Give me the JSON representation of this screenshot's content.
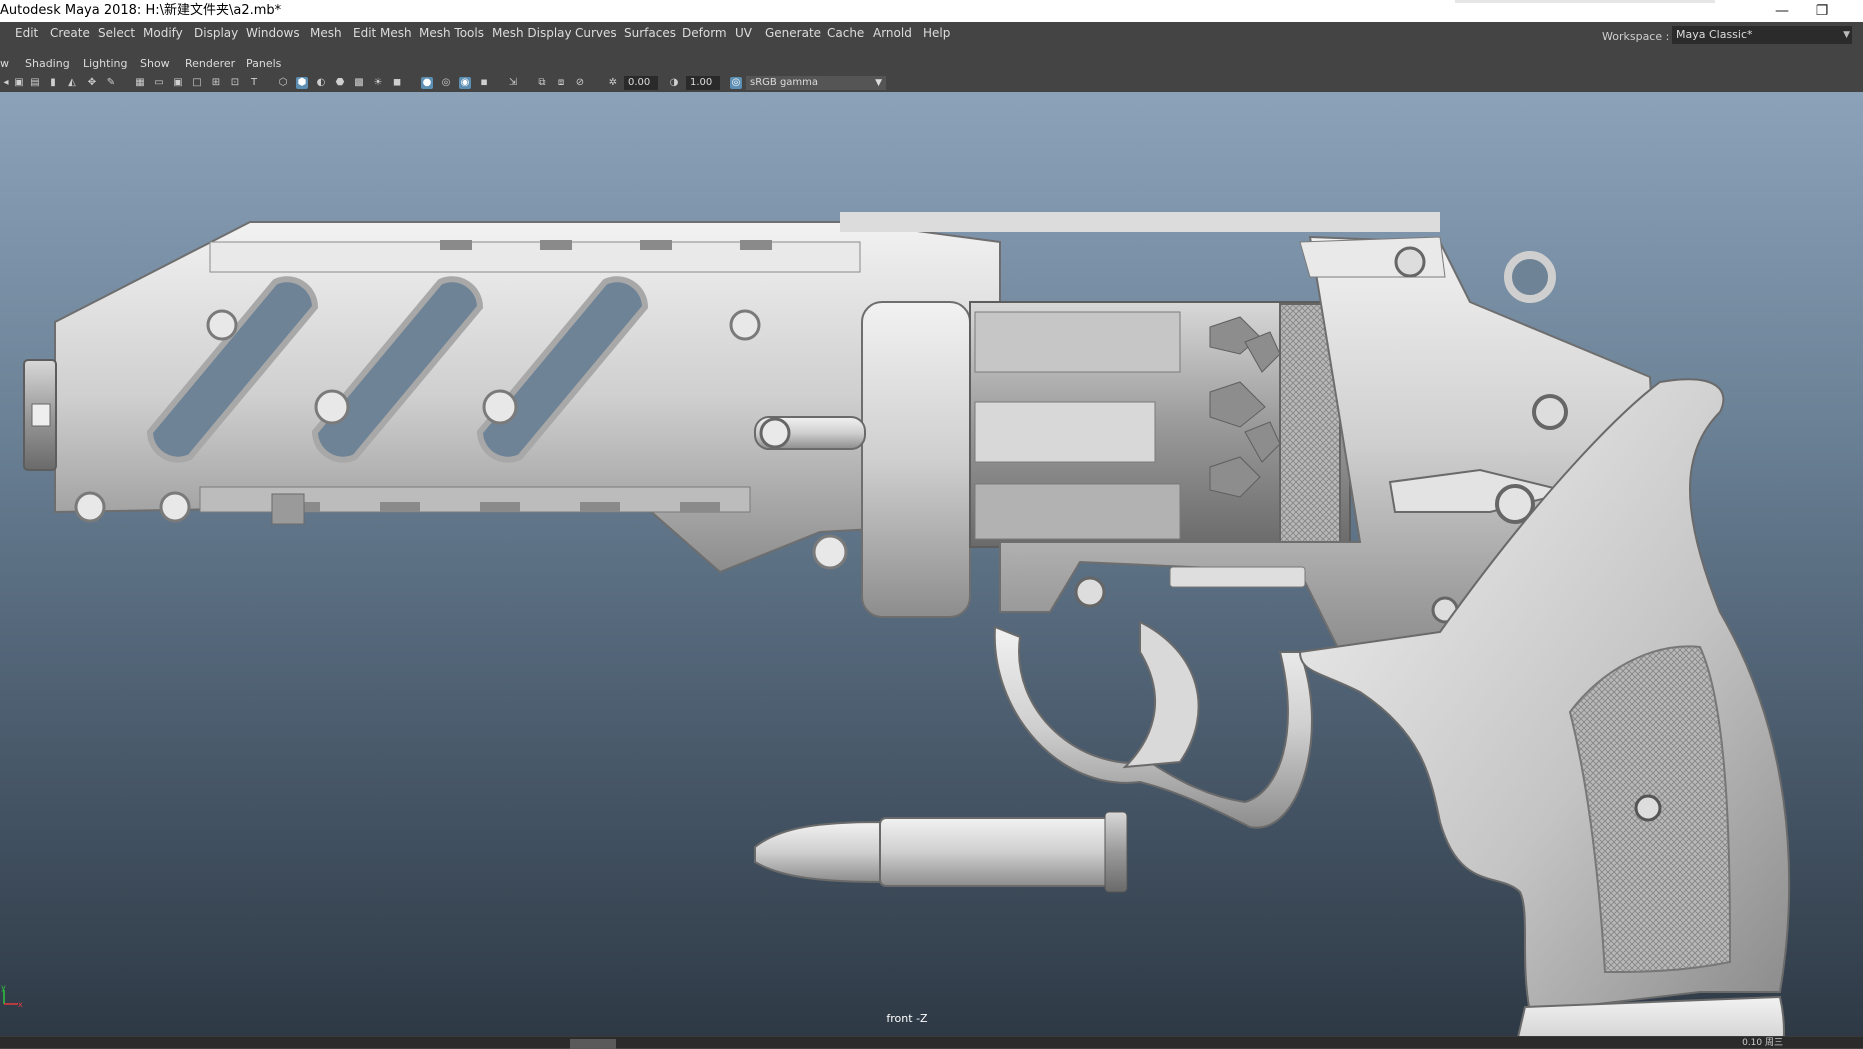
{
  "window": {
    "title": "Autodesk Maya 2018: H:\\新建文件夹\\a2.mb*",
    "minimize_glyph": "—",
    "restore_glyph": "❐"
  },
  "menu": {
    "items": [
      "Edit",
      "Create",
      "Select",
      "Modify",
      "Display",
      "Windows",
      "Mesh",
      "Edit Mesh",
      "Mesh Tools",
      "Mesh Display",
      "Curves",
      "Surfaces",
      "Deform",
      "UV",
      "Generate",
      "Cache",
      "Arnold",
      "Help"
    ]
  },
  "workspace": {
    "label": "Workspace :",
    "value": "Maya Classic*"
  },
  "panel_menu": {
    "items": [
      "w",
      "Shading",
      "Lighting",
      "Show",
      "Renderer",
      "Panels"
    ]
  },
  "toolbar": {
    "exposure": "0.00",
    "gamma": "1.00",
    "color_space": "sRGB gamma"
  },
  "viewport": {
    "camera_label": "front -Z",
    "axis_y": "y",
    "axis_x": "x"
  },
  "statusbar": {
    "text": "0.10 周三"
  },
  "colors": {
    "menu_bg": "#444444",
    "field_bg": "#2a2a2a",
    "active_icon": "#5d8fb3",
    "viewport_top": "#8ca2b9",
    "viewport_bottom": "#2e3945"
  }
}
